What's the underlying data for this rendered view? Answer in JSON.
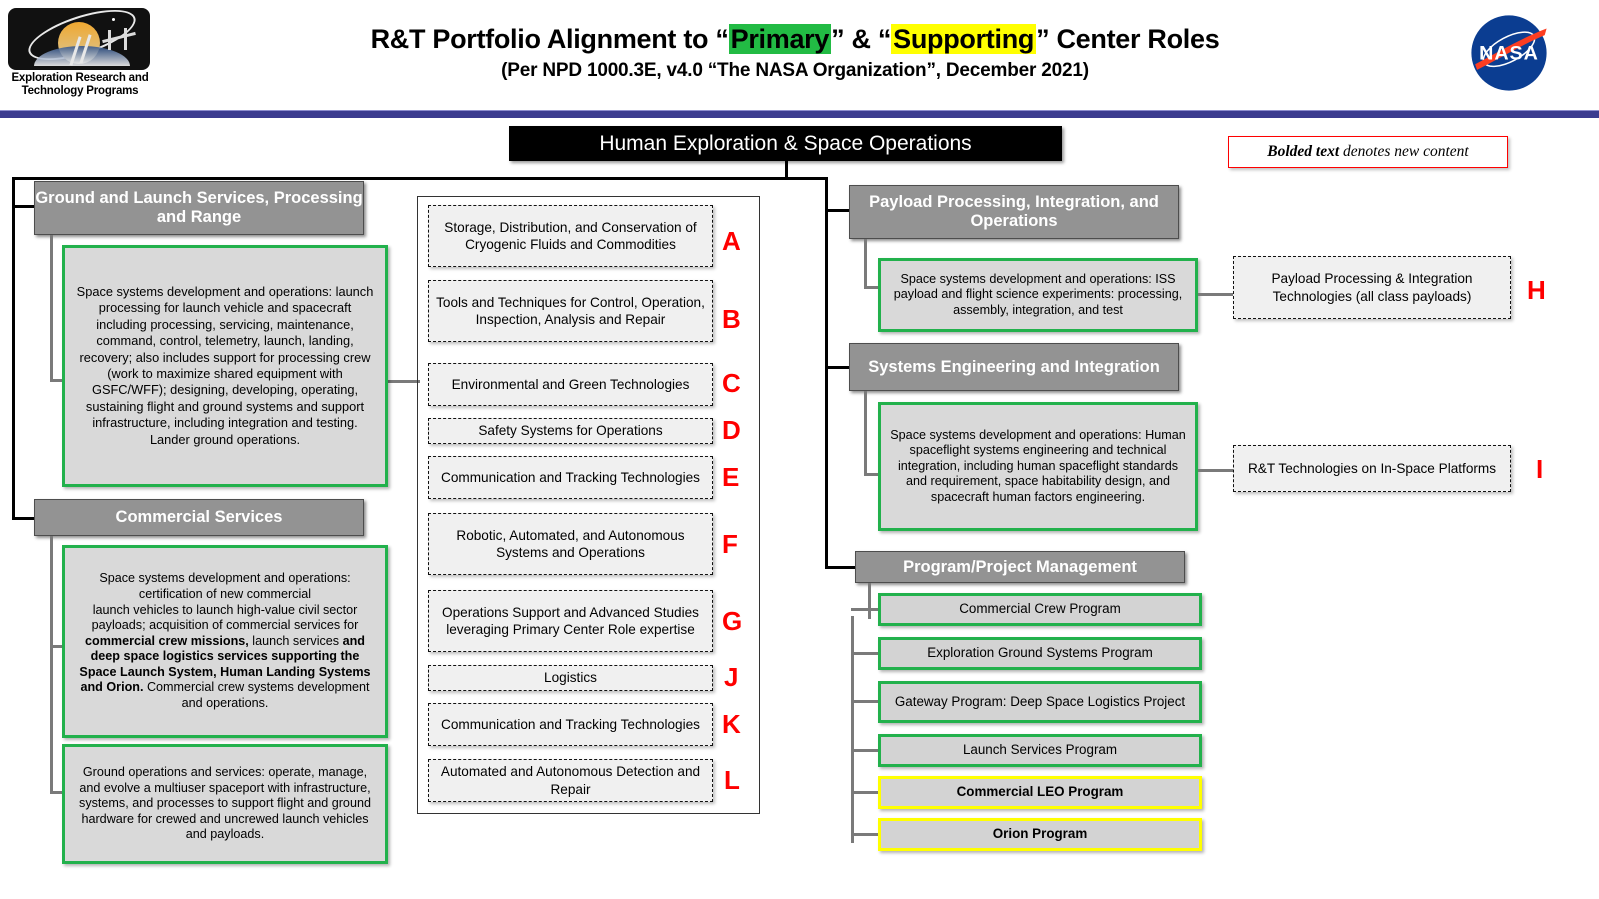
{
  "header": {
    "logo_caption": "Exploration Research and Technology Programs",
    "logo_icon": "saturn-iss-logo",
    "title_pre": "R&T Portfolio Alignment to “",
    "title_primary": "Primary",
    "title_mid": "” &  “",
    "title_supporting": "Supporting",
    "title_post": "” Center Roles",
    "subtitle": "(Per NPD 1000.3E, v4.0 “The NASA Organization”, December 2021)",
    "nasa_logo": "nasa-meatball-logo",
    "primary_color": "#22bb44",
    "supporting_color": "#ffff00",
    "bar_color": "#3b3b8f"
  },
  "top_node": {
    "label": "Human Exploration & Space Operations"
  },
  "legend": {
    "bold_text": "Bolded text",
    "rest": " denotes new content",
    "border_color": "#ff0000"
  },
  "left_column": {
    "groups": [
      {
        "title": "Ground and Launch Services, Processing and Range",
        "descriptions": [
          "Space systems development and operations: launch processing for launch vehicle and spacecraft including processing, servicing, maintenance, command, control, telemetry, launch, landing, recovery; also includes support for processing crew (work to maximize shared equipment with GSFC/WFF); designing, developing, operating, sustaining flight and ground systems and support infrastructure, including integration and testing. Lander ground operations."
        ]
      },
      {
        "title": "Commercial Services",
        "descriptions": [
          "Space systems development and operations: certification of new commercial launch vehicles to launch high-value civil sector payloads; acquisition of commercial services for commercial crew missions, launch services and deep space logistics services supporting the Space Launch System, Human Landing Systems and Orion. Commercial crew systems development and operations.",
          "Ground operations and services: operate, manage, and evolve a multiuser spaceport with infrastructure, systems, and processes to support flight and ground hardware for crewed and uncrewed launch vehicles and payloads."
        ]
      }
    ]
  },
  "center_column": {
    "items": [
      {
        "letter": "A",
        "label": "Storage, Distribution, and Conservation of Cryogenic Fluids and Commodities"
      },
      {
        "letter": "B",
        "label": "Tools and Techniques for Control, Operation, Inspection, Analysis and Repair"
      },
      {
        "letter": "C",
        "label": "Environmental and Green Technologies"
      },
      {
        "letter": "D",
        "label": "Safety Systems for Operations"
      },
      {
        "letter": "E",
        "label": "Communication and Tracking Technologies"
      },
      {
        "letter": "F",
        "label": "Robotic, Automated, and Autonomous Systems and Operations"
      },
      {
        "letter": "G",
        "label": "Operations Support and Advanced Studies leveraging Primary Center Role expertise"
      },
      {
        "letter": "J",
        "label": "Logistics"
      },
      {
        "letter": "K",
        "label": "Communication and Tracking Technologies"
      },
      {
        "letter": "L",
        "label": "Automated and Autonomous Detection and Repair"
      }
    ]
  },
  "right_column": {
    "groups": [
      {
        "title": "Payload Processing, Integration, and Operations",
        "description": "Space systems development and operations: ISS payload and flight science experiments: processing, assembly, integration, and test",
        "tech": {
          "letter": "H",
          "label": "Payload Processing & Integration Technologies (all class payloads)"
        }
      },
      {
        "title": "Systems Engineering and Integration",
        "description": "Space systems development and operations: Human spaceflight systems engineering and technical integration, including human spaceflight standards and requirement, space habitability design, and spacecraft human factors engineering.",
        "tech": {
          "letter": "I",
          "label": "R&T Technologies on In-Space Platforms"
        }
      }
    ],
    "programs_group": {
      "title": "Program/Project Management",
      "programs": [
        {
          "label": "Commercial Crew Program",
          "highlight": "green"
        },
        {
          "label": "Exploration Ground Systems Program",
          "highlight": "green"
        },
        {
          "label": "Gateway Program: Deep Space Logistics Project",
          "highlight": "green"
        },
        {
          "label": "Launch Services Program",
          "highlight": "green"
        },
        {
          "label": "Commercial LEO Program",
          "highlight": "yellow"
        },
        {
          "label": "Orion Program",
          "highlight": "yellow"
        }
      ]
    }
  }
}
